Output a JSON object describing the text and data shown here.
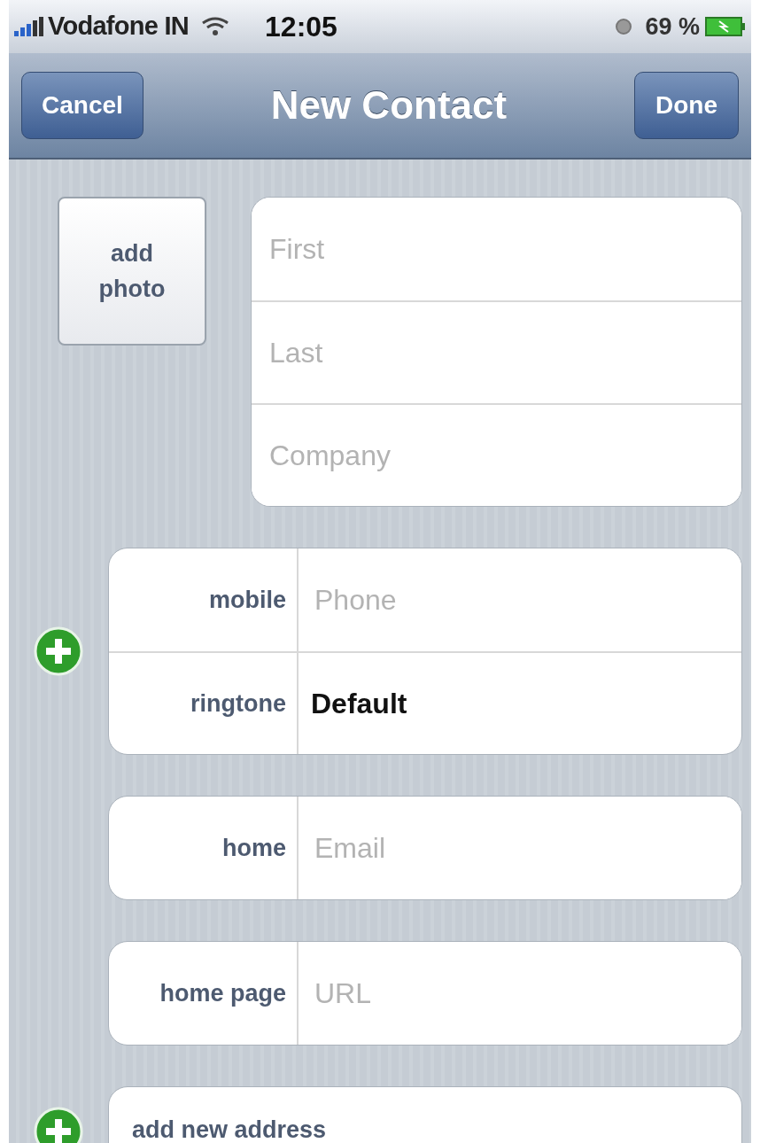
{
  "status_bar": {
    "carrier": "Vodafone IN",
    "time": "12:05",
    "battery": "69 %"
  },
  "nav_bar": {
    "title": "New Contact",
    "left_button": "Cancel",
    "right_button": "Done"
  },
  "photo": {
    "label": "add photo"
  },
  "name_fields": [
    {
      "placeholder": "First"
    },
    {
      "placeholder": "Last"
    },
    {
      "placeholder": "Company"
    }
  ],
  "groups": [
    {
      "add_button": true,
      "rows": [
        {
          "kind": "field",
          "label": "mobile",
          "placeholder": "Phone"
        },
        {
          "kind": "value",
          "label": "ringtone",
          "value": "Default"
        }
      ]
    },
    {
      "add_button": false,
      "rows": [
        {
          "kind": "field",
          "label": "home",
          "placeholder": "Email"
        }
      ]
    },
    {
      "add_button": false,
      "rows": [
        {
          "kind": "field",
          "label": "home page",
          "placeholder": "URL"
        }
      ]
    },
    {
      "add_button": true,
      "rows": [
        {
          "kind": "action",
          "label": "add new address"
        }
      ]
    }
  ]
}
